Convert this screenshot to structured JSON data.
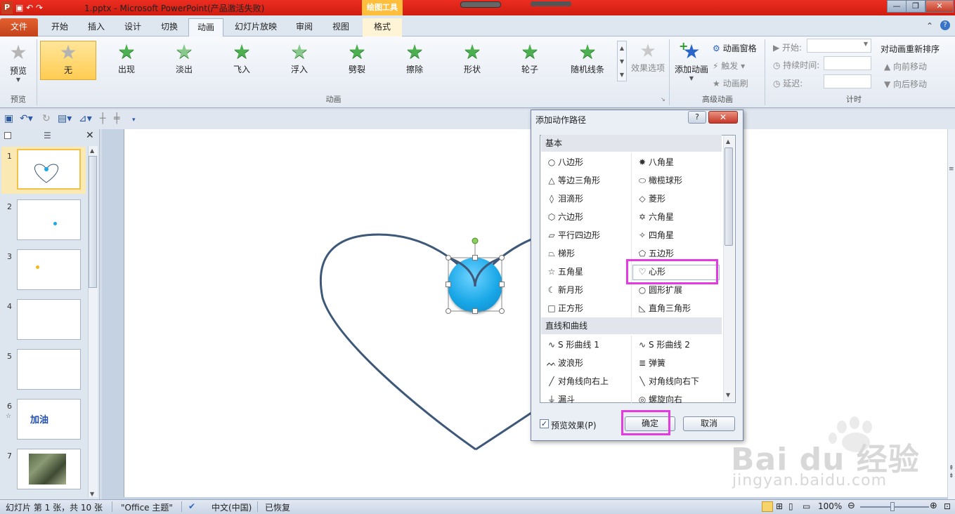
{
  "window": {
    "app_icon": "P",
    "title": "1.pptx  -  Microsoft PowerPoint(产品激活失败)",
    "context_tab_header": "绘图工具",
    "min_icon": "minimize-icon",
    "max_icon": "restore-icon",
    "close_glyph": "✕",
    "min_glyph": "—",
    "max_glyph": "❐"
  },
  "tabs": [
    "文件",
    "开始",
    "插入",
    "设计",
    "切换",
    "动画",
    "幻灯片放映",
    "审阅",
    "视图",
    "格式"
  ],
  "active_tab": "动画",
  "ribbon": {
    "preview_label": "预览",
    "preview_group": "预览",
    "animation_group": "动画",
    "animations": [
      "无",
      "出现",
      "淡出",
      "飞入",
      "浮入",
      "劈裂",
      "擦除",
      "形状",
      "轮子",
      "随机线条"
    ],
    "effect_options": "效果选项",
    "add_animation": "添加动画",
    "animation_pane": "动画窗格",
    "trigger": "触发",
    "animation_painter": "动画刷",
    "advanced_group": "高级动画",
    "start_label": "开始:",
    "duration_label": "持续时间:",
    "delay_label": "延迟:",
    "timing_group": "计时",
    "reorder_title": "对动画重新排序",
    "move_earlier": "向前移动",
    "move_later": "向后移动"
  },
  "slides": [
    {
      "num": "1"
    },
    {
      "num": "2"
    },
    {
      "num": "3"
    },
    {
      "num": "4"
    },
    {
      "num": "5"
    },
    {
      "num": "6",
      "text": "加油"
    },
    {
      "num": "7"
    }
  ],
  "dialog": {
    "title": "添加动作路径",
    "help": "?",
    "close": "✕",
    "section_basic": "基本",
    "basic_left": [
      "八边形",
      "等边三角形",
      "泪滴形",
      "六边形",
      "平行四边形",
      "梯形",
      "五角星",
      "新月形",
      "正方形"
    ],
    "basic_right": [
      "八角星",
      "橄榄球形",
      "菱形",
      "六角星",
      "四角星",
      "五边形",
      "心形",
      "圆形扩展",
      "直角三角形"
    ],
    "section_lines": "直线和曲线",
    "lines_left": [
      "S 形曲线 1",
      "波浪形",
      "对角线向右上",
      "漏斗"
    ],
    "lines_right": [
      "S 形曲线 2",
      "弹簧",
      "对角线向右下",
      "螺旋向右"
    ],
    "preview_effect": "预览效果(P)",
    "ok": "确定",
    "cancel": "取消"
  },
  "status": {
    "slide_info": "幻灯片 第 1 张，共 10 张",
    "theme": "\"Office 主题\"",
    "language": "中文(中国)",
    "recovered": "已恢复",
    "zoom": "100%"
  },
  "watermark": {
    "text": "Bai du 经验",
    "url": "jingyan.baidu.com"
  },
  "colors": {
    "title_bar": "#d01c10",
    "accent_orange": "#c4421a",
    "highlight_magenta": "#e43be0",
    "heart_stroke": "#3d5878",
    "circle_fill": "#1aa8e8"
  }
}
